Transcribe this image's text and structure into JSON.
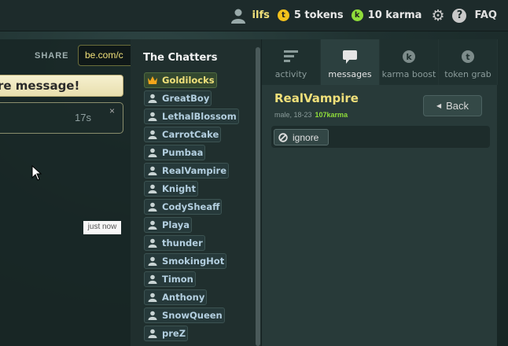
{
  "topbar": {
    "username": "ilfs",
    "tokens": "5 tokens",
    "token_letter": "t",
    "karma": "10 karma",
    "karma_letter": "k",
    "faq": "FAQ"
  },
  "left": {
    "share_label": "SHARE",
    "share_url": "be.com/c",
    "banner_text": "re message!",
    "msg_time": "17s",
    "close": "×",
    "just_now": "just now"
  },
  "chatters": {
    "title": "The Chatters",
    "host": "Goldilocks",
    "users": [
      "GreatBoy",
      "LethalBlossom",
      "CarrotCake",
      "Pumbaa",
      "RealVampire",
      "Knight",
      "CodySheaff",
      "Playa",
      "thunder",
      "SmokingHot",
      "Timon",
      "Anthony",
      "SnowQueen",
      "preZ"
    ]
  },
  "tabs": [
    {
      "label": "activity",
      "icon": "activity-icon"
    },
    {
      "label": "messages",
      "icon": "messages-icon"
    },
    {
      "label": "karma boost",
      "icon": "karma-boost-icon",
      "letter": "k"
    },
    {
      "label": "token grab",
      "icon": "token-grab-icon",
      "letter": "t"
    }
  ],
  "profile": {
    "name": "RealVampire",
    "meta": "male, 18-23",
    "karma": "107karma",
    "back_label": "Back",
    "ignore_label": "ignore"
  },
  "colors": {
    "accent_yellow": "#f0e07a",
    "karma_green": "#8fdc3a",
    "token_gold": "#f4c11c"
  }
}
